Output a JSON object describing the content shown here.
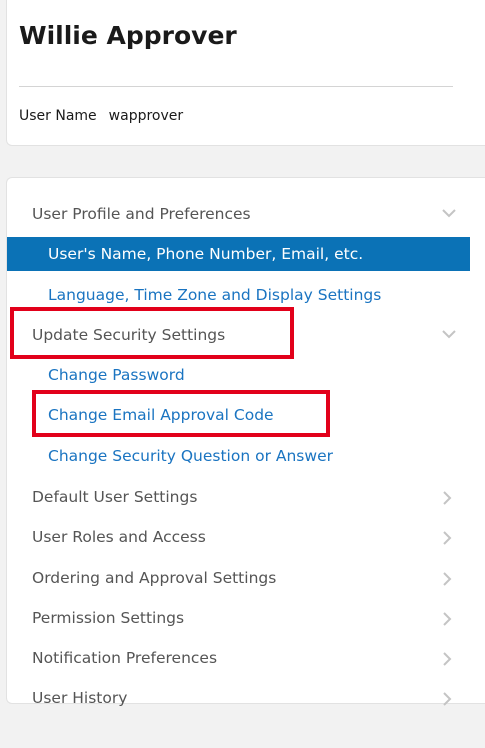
{
  "profile": {
    "full_name": "Willie Approver",
    "username_label": "User Name",
    "username_value": "wapprover"
  },
  "menu": {
    "user_profile": {
      "label": "User Profile and Preferences",
      "items": {
        "name_phone_email": "User's Name, Phone Number, Email, etc.",
        "language_timezone": "Language, Time Zone and Display Settings"
      }
    },
    "security": {
      "label": "Update Security Settings",
      "items": {
        "change_password": "Change Password",
        "change_email_code": "Change Email Approval Code",
        "change_question": "Change Security Question or Answer"
      }
    },
    "default_user_settings": "Default User Settings",
    "user_roles": "User Roles and Access",
    "ordering_approval": "Ordering and Approval Settings",
    "permission_settings": "Permission Settings",
    "notification_prefs": "Notification Preferences",
    "user_history": "User History"
  },
  "icons": {
    "expanded": "chevron-down-icon",
    "collapsed": "chevron-right-icon"
  },
  "colors": {
    "active_background": "#0b72b6",
    "link": "#1a74c1",
    "section_text": "#555555",
    "chevron": "#c4c4c4",
    "highlight_box": "#e2001a"
  }
}
